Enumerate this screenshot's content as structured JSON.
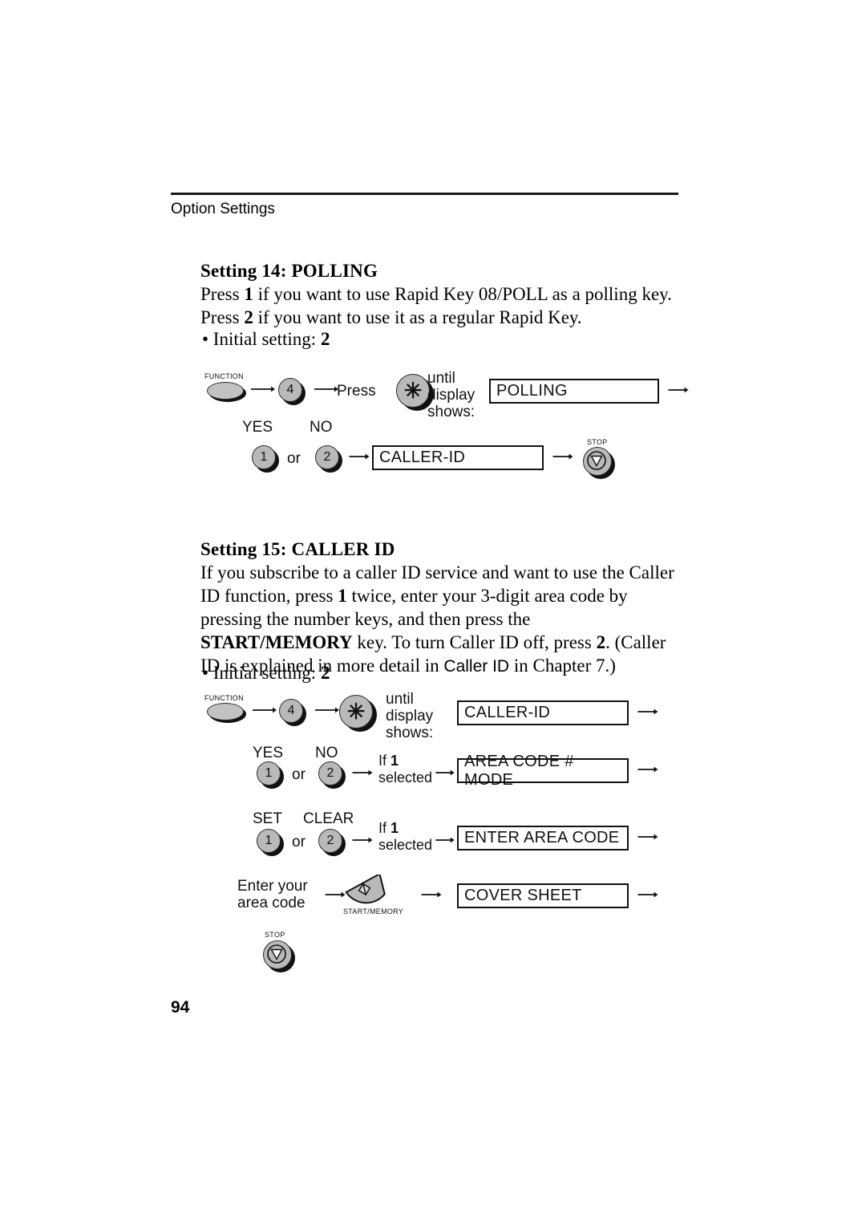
{
  "page": {
    "running_header": "Option Settings",
    "page_number": "94"
  },
  "sections": [
    {
      "heading": "Setting 14: POLLING",
      "paragraph_html": "Press <b>1</b> if you want to use Rapid Key 08/POLL as a polling key. Press <b>2</b> if you want to use it as a regular Rapid Key.",
      "initial_setting_label": "• Initial setting:",
      "initial_setting_value": "2"
    },
    {
      "heading": "Setting 15: CALLER ID",
      "paragraph_html": "If you subscribe to a caller ID service and want to use the Caller ID function, press <b>1</b> twice, enter your 3-digit area code by pressing the number keys, and then press the <b>START/MEMORY</b> key. To turn Caller ID off, press <b>2</b>. (Caller ID is explained in more detail in <span class=\"sans-inline\">Caller ID</span> in Chapter 7.)",
      "initial_setting_label": "• Initial setting:",
      "initial_setting_value": "2"
    }
  ],
  "diagram_polling": {
    "function_key_caption": "FUNCTION",
    "number_key_4": "4",
    "press_label": "Press",
    "star_key": "✳",
    "until_line1": "until",
    "until_line2": "display",
    "until_line3": "shows:",
    "display_polling": "POLLING",
    "yes_label": "YES",
    "no_label": "NO",
    "number_key_1": "1",
    "or_label": "or",
    "number_key_2": "2",
    "display_callerid": "CALLER-ID",
    "stop_caption": "STOP"
  },
  "diagram_caller_id": {
    "function_key_caption": "FUNCTION",
    "number_key_4": "4",
    "star_key": "✳",
    "until_line1": "until",
    "until_line2": "display",
    "until_line3": "shows:",
    "display_callerid": "CALLER-ID",
    "yes_label": "YES",
    "no_label": "NO",
    "number_key_1": "1",
    "or_label": "or",
    "number_key_2": "2",
    "if1_line1_prefix": "If ",
    "if1_line1_value": "1",
    "if1_line2": "selected",
    "display_area_code_mode": "AREA CODE # MODE",
    "set_label": "SET",
    "clear_label": "CLEAR",
    "number_key_1b": "1",
    "or_label_b": "or",
    "number_key_2b": "2",
    "if1b_line1_prefix": "If ",
    "if1b_line1_value": "1",
    "if1b_line2": "selected",
    "display_enter_area_code": "ENTER AREA CODE",
    "enter_line1": "Enter your",
    "enter_line2": "area code",
    "start_memory_caption": "START/MEMORY",
    "display_cover_sheet": "COVER SHEET",
    "stop_caption": "STOP"
  },
  "colors": {
    "key_face": "#b9b9b9",
    "key_shadow": "#111111",
    "ink": "#111111"
  }
}
